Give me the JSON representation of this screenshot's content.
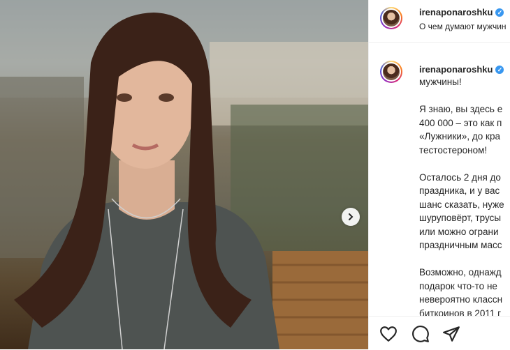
{
  "post": {
    "username": "irenaponaroshku",
    "header_subtitle": "О чем думают мужчин",
    "caption": "мужчины!\n\nЯ знаю, вы здесь е\n400 000 – это как п\n«Лужники», до кра\nтестостероном!\n\nОсталось 2 дня до\nпраздника, и у вас\nшанс сказать, нуже\nшуруповёрт, трусы\nили можно ограни\nпраздничным масс\n\nВозможно, однажд\nподарок что-то не\nневероятно классн\nбиткоинов в 2011 г"
  },
  "icons": {
    "verified": "✓",
    "next": "next-chevron-icon",
    "like": "heart-icon",
    "comment": "comment-icon",
    "share": "share-icon"
  },
  "colors": {
    "verified": "#3897f0",
    "text": "#262626",
    "border": "#efefef"
  }
}
